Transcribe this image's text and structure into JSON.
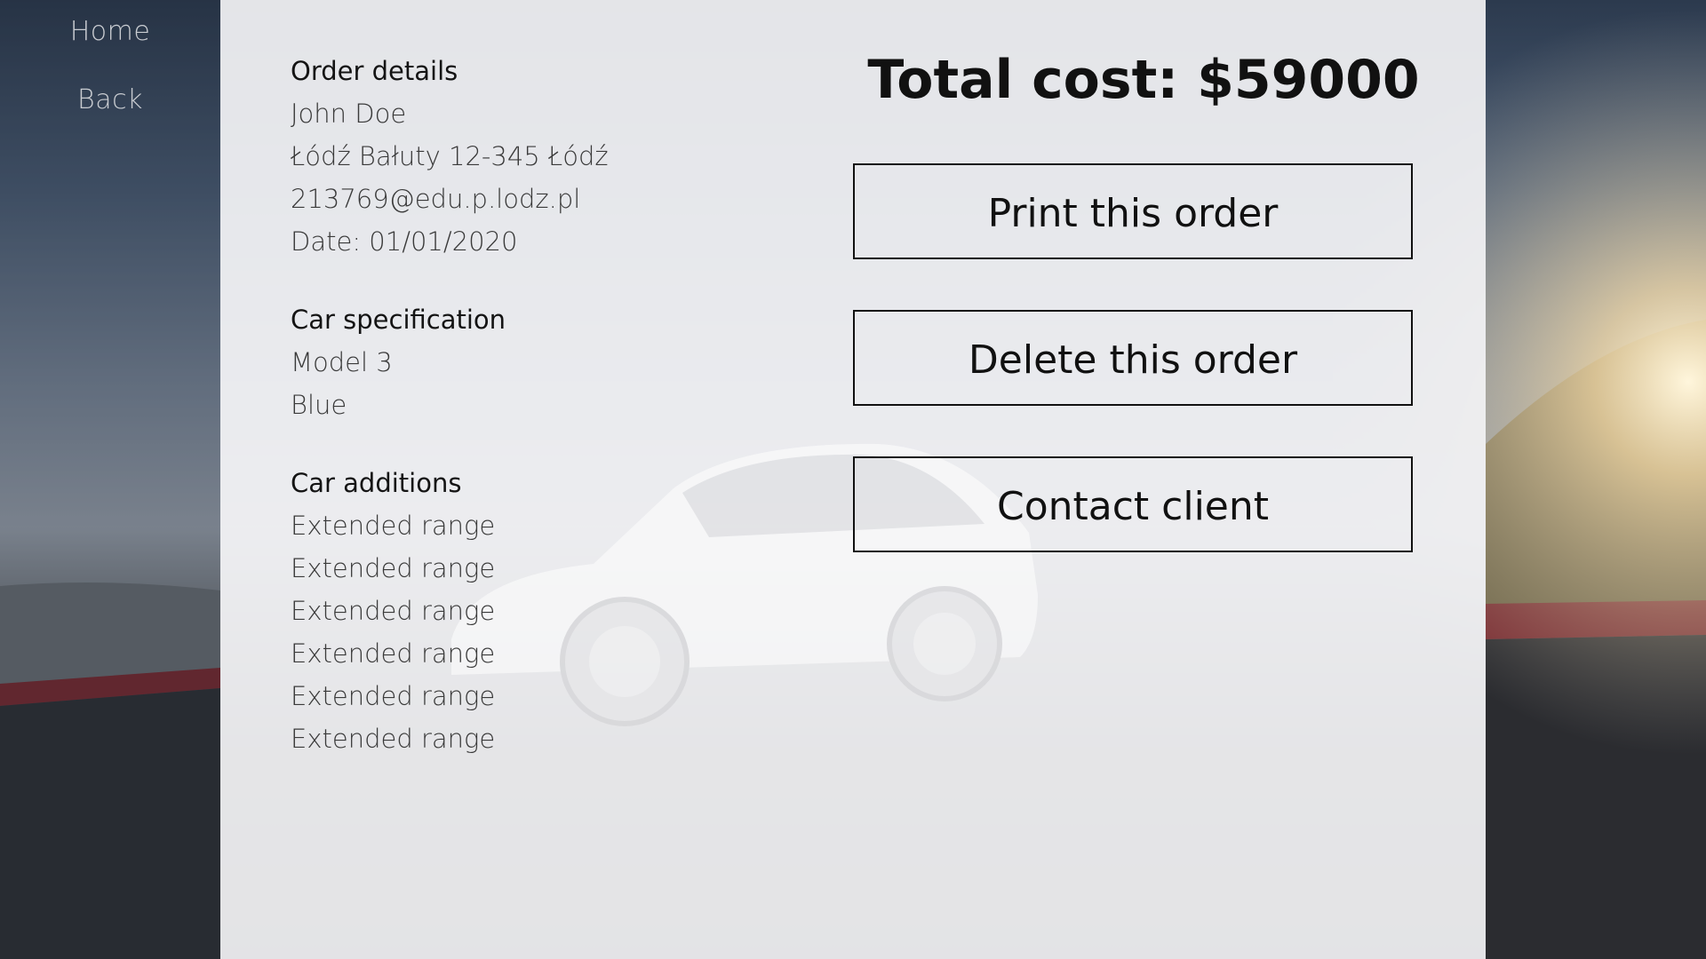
{
  "nav": {
    "home_label": "Home",
    "back_label": "Back"
  },
  "order_details": {
    "title": "Order details",
    "name": "John Doe",
    "address": "Łódź Bałuty 12-345 Łódź",
    "email": "213769@edu.p.lodz.pl",
    "date": "Date: 01/01/2020"
  },
  "car_specification": {
    "title": "Car specification",
    "model": "Model 3",
    "color": "Blue"
  },
  "car_additions": {
    "title": "Car additions",
    "items": [
      "Extended range",
      "Extended range",
      "Extended range",
      "Extended range",
      "Extended range",
      "Extended range"
    ]
  },
  "summary": {
    "total_cost": "Total cost: $59000"
  },
  "actions": {
    "print_label": "Print this order",
    "delete_label": "Delete this order",
    "contact_label": "Contact client"
  },
  "colors": {
    "panel_bg": "#f2f2f4",
    "text_primary": "#111111",
    "text_secondary": "#3a3a3a",
    "nav_text": "#c9ccd1"
  }
}
